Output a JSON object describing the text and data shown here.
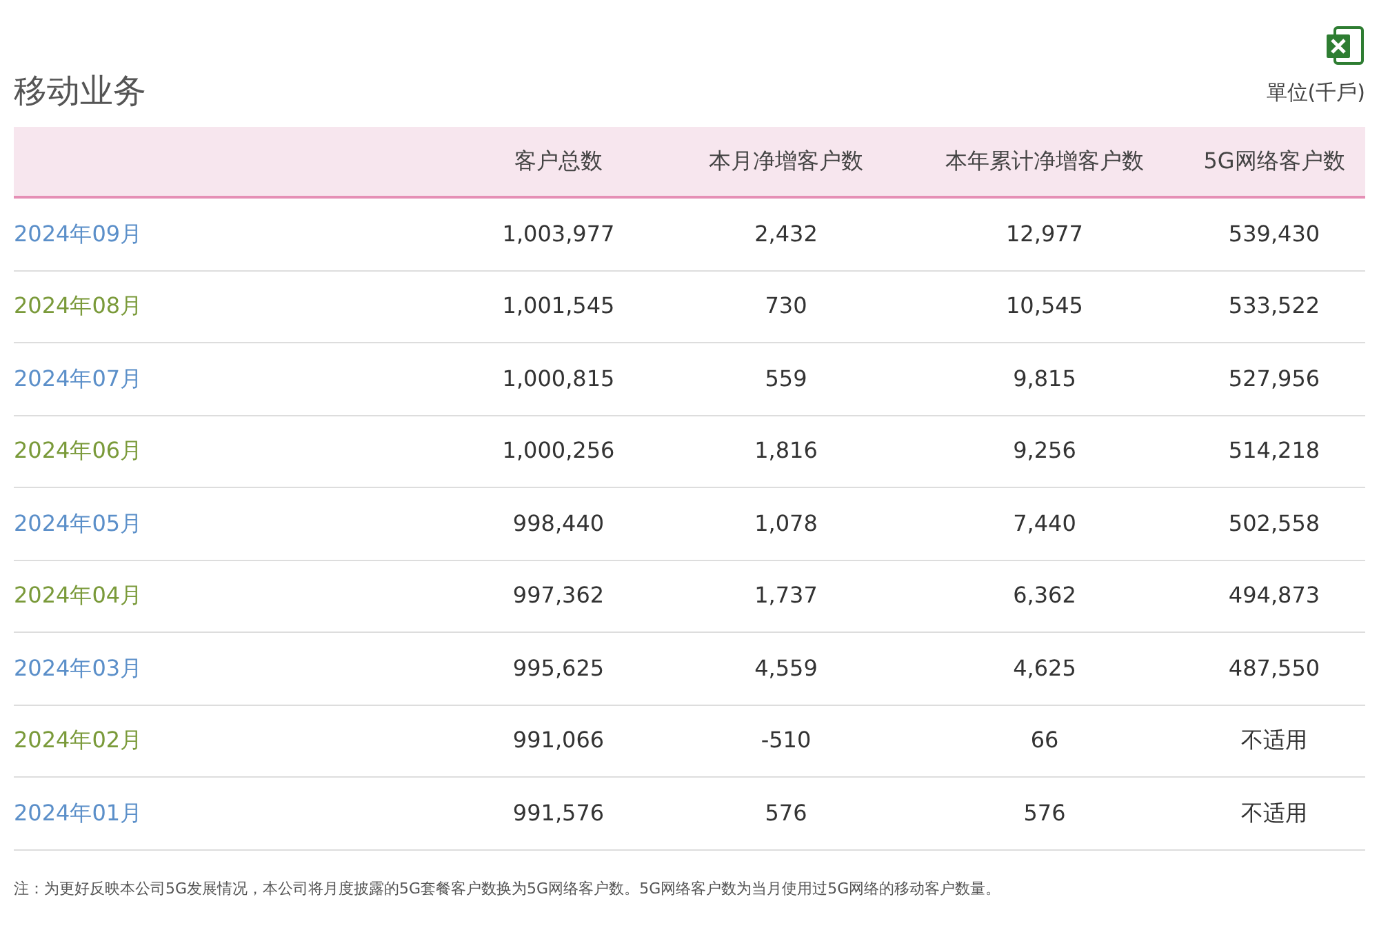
{
  "title": "移动业务",
  "unit": "單位(千戶)",
  "table": {
    "columns": [
      "",
      "客户总数",
      "本月净增客户数",
      "本年累计净增客户数",
      "5G网络客户数"
    ],
    "rows": [
      {
        "color": "#5b8fc9",
        "cells": [
          "2024年09月",
          "1,003,977",
          "2,432",
          "12,977",
          "539,430"
        ]
      },
      {
        "color": "#7a9a3a",
        "cells": [
          "2024年08月",
          "1,001,545",
          "730",
          "10,545",
          "533,522"
        ]
      },
      {
        "color": "#5b8fc9",
        "cells": [
          "2024年07月",
          "1,000,815",
          "559",
          "9,815",
          "527,956"
        ]
      },
      {
        "color": "#7a9a3a",
        "cells": [
          "2024年06月",
          "1,000,256",
          "1,816",
          "9,256",
          "514,218"
        ]
      },
      {
        "color": "#5b8fc9",
        "cells": [
          "2024年05月",
          "998,440",
          "1,078",
          "7,440",
          "502,558"
        ]
      },
      {
        "color": "#7a9a3a",
        "cells": [
          "2024年04月",
          "997,362",
          "1,737",
          "6,362",
          "494,873"
        ]
      },
      {
        "color": "#5b8fc9",
        "cells": [
          "2024年03月",
          "995,625",
          "4,559",
          "4,625",
          "487,550"
        ]
      },
      {
        "color": "#7a9a3a",
        "cells": [
          "2024年02月",
          "991,066",
          "-510",
          "66",
          "不适用"
        ]
      },
      {
        "color": "#5b8fc9",
        "cells": [
          "2024年01月",
          "991,576",
          "576",
          "576",
          "不适用"
        ]
      }
    ]
  },
  "note": "注：为更好反映本公司5G发展情况，本公司将月度披露的5G套餐客户数换为5G网络客户数。5G网络客户数为当月使用过5G网络的移动客户数量。"
}
